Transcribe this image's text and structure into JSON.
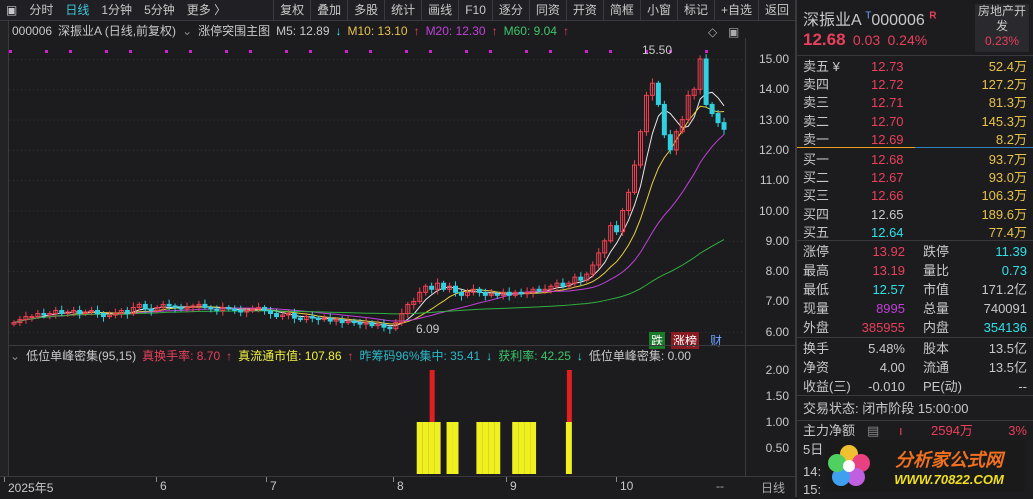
{
  "toolbar": {
    "items": [
      "分时",
      "日线",
      "1分钟",
      "5分钟",
      "更多 〉",
      "复权",
      "叠加",
      "多股",
      "统计",
      "画线",
      "F10",
      "逐分",
      "同资",
      "开资",
      "简框",
      "小窗",
      "标记",
      "+自选",
      "返回"
    ],
    "active": "日线"
  },
  "chart_header": {
    "code": "000006",
    "name": "深振业A (日线,前复权)",
    "template": "涨停突围主图",
    "m5": "M5: 12.89",
    "m10": "M10: 13.10",
    "m20": "M20: 12.30",
    "m60": "M60: 9.04"
  },
  "price_axis": [
    "15.00",
    "14.00",
    "13.00",
    "12.00",
    "11.00",
    "10.00",
    "9.00",
    "8.00",
    "7.00",
    "6.00"
  ],
  "annotations": {
    "high": "15.50",
    "low": "6.09"
  },
  "badges": {
    "down": "跌",
    "limit": "涨榜",
    "fin": "财"
  },
  "indicator_header": {
    "name": "低位单峰密集(95,15)",
    "turnover": "真换手率: 8.70",
    "float_cap": "真流通市值: 107.86",
    "chip": "昨筹码96%集中: 35.41",
    "profit": "获利率: 42.25",
    "peak": "低位单峰密集: 0.00"
  },
  "indicator_axis": [
    "2.00",
    "1.50",
    "1.00",
    "0.50"
  ],
  "dates": {
    "labels": [
      "2025年5",
      "6",
      "7",
      "8",
      "9",
      "10"
    ],
    "period": "日线",
    "more": "--"
  },
  "chart_data": {
    "type": "candlestick",
    "ylim": [
      5.8,
      15.3
    ],
    "closes": [
      6.3,
      6.4,
      6.5,
      6.5,
      6.6,
      6.55,
      6.6,
      6.7,
      6.6,
      6.65,
      6.7,
      6.6,
      6.65,
      6.7,
      6.6,
      6.5,
      6.55,
      6.6,
      6.7,
      6.6,
      6.8,
      6.9,
      6.75,
      6.7,
      6.8,
      6.9,
      6.85,
      6.8,
      6.75,
      6.8,
      6.85,
      6.9,
      6.8,
      6.75,
      6.7,
      6.8,
      6.75,
      6.7,
      6.65,
      6.7,
      6.75,
      6.8,
      6.7,
      6.6,
      6.5,
      6.55,
      6.6,
      6.45,
      6.4,
      6.5,
      6.45,
      6.4,
      6.45,
      6.35,
      6.4,
      6.3,
      6.35,
      6.3,
      6.25,
      6.3,
      6.2,
      6.25,
      6.15,
      6.1,
      6.3,
      6.6,
      6.9,
      7.0,
      7.3,
      7.5,
      7.4,
      7.6,
      7.4,
      7.5,
      7.3,
      7.2,
      7.3,
      7.4,
      7.3,
      7.2,
      7.25,
      7.2,
      7.3,
      7.2,
      7.3,
      7.25,
      7.3,
      7.4,
      7.35,
      7.4,
      7.5,
      7.6,
      7.5,
      7.6,
      7.8,
      7.7,
      7.9,
      8.2,
      8.6,
      9.0,
      9.5,
      9.3,
      10.0,
      10.6,
      11.5,
      12.6,
      13.8,
      14.2,
      13.5,
      12.5,
      12.0,
      12.6,
      13.0,
      13.8,
      14.0,
      15.0,
      13.5,
      13.2,
      12.9,
      12.68
    ],
    "indicator": {
      "yellow": [
        68,
        69,
        70,
        71,
        73,
        74,
        78,
        79,
        80,
        81,
        84,
        85,
        86,
        87,
        93
      ],
      "red": [
        70,
        93
      ]
    }
  },
  "quote": {
    "name": "深振业A",
    "code": "000006",
    "flag": "R",
    "t": "T",
    "price": "12.68",
    "change": "0.03",
    "pct": "0.24%",
    "sector": "房地产开发",
    "sector_pct": "0.23%"
  },
  "asks": [
    {
      "l": "卖五 ¥",
      "p": "12.73",
      "v": "52.4万"
    },
    {
      "l": "卖四",
      "p": "12.72",
      "v": "127.2万"
    },
    {
      "l": "卖三",
      "p": "12.71",
      "v": "81.3万"
    },
    {
      "l": "卖二",
      "p": "12.70",
      "v": "145.3万"
    },
    {
      "l": "卖一",
      "p": "12.69",
      "v": "8.2万"
    }
  ],
  "bids": [
    {
      "l": "买一",
      "p": "12.68",
      "v": "93.7万"
    },
    {
      "l": "买二",
      "p": "12.67",
      "v": "93.0万"
    },
    {
      "l": "买三",
      "p": "12.66",
      "v": "106.3万"
    },
    {
      "l": "买四",
      "p": "12.65",
      "v": "189.6万"
    },
    {
      "l": "买五",
      "p": "12.64",
      "v": "77.4万"
    }
  ],
  "stats": [
    [
      "涨停",
      "13.92",
      "跌停",
      "11.39"
    ],
    [
      "最高",
      "13.19",
      "量比",
      "0.73"
    ],
    [
      "最低",
      "12.57",
      "市值",
      "171.2亿"
    ],
    [
      "现量",
      "8995",
      "总量",
      "740091"
    ],
    [
      "外盘",
      "385955",
      "内盘",
      "354136"
    ]
  ],
  "stats2": [
    [
      "换手",
      "5.48%",
      "股本",
      "13.5亿"
    ],
    [
      "净资",
      "4.00",
      "流通",
      "13.5亿"
    ],
    [
      "收益(三)",
      "-0.010",
      "PE(动)",
      "--"
    ]
  ],
  "status": "交易状态: 闭市阶段 15:00:00",
  "mainflow": {
    "label": "主力净额",
    "value": "2594万",
    "pct": "3%"
  },
  "rows_below": [
    "5日",
    "14:",
    "15:"
  ],
  "watermark": {
    "text": "分析家公式网",
    "url": "WWW.70822.COM"
  }
}
